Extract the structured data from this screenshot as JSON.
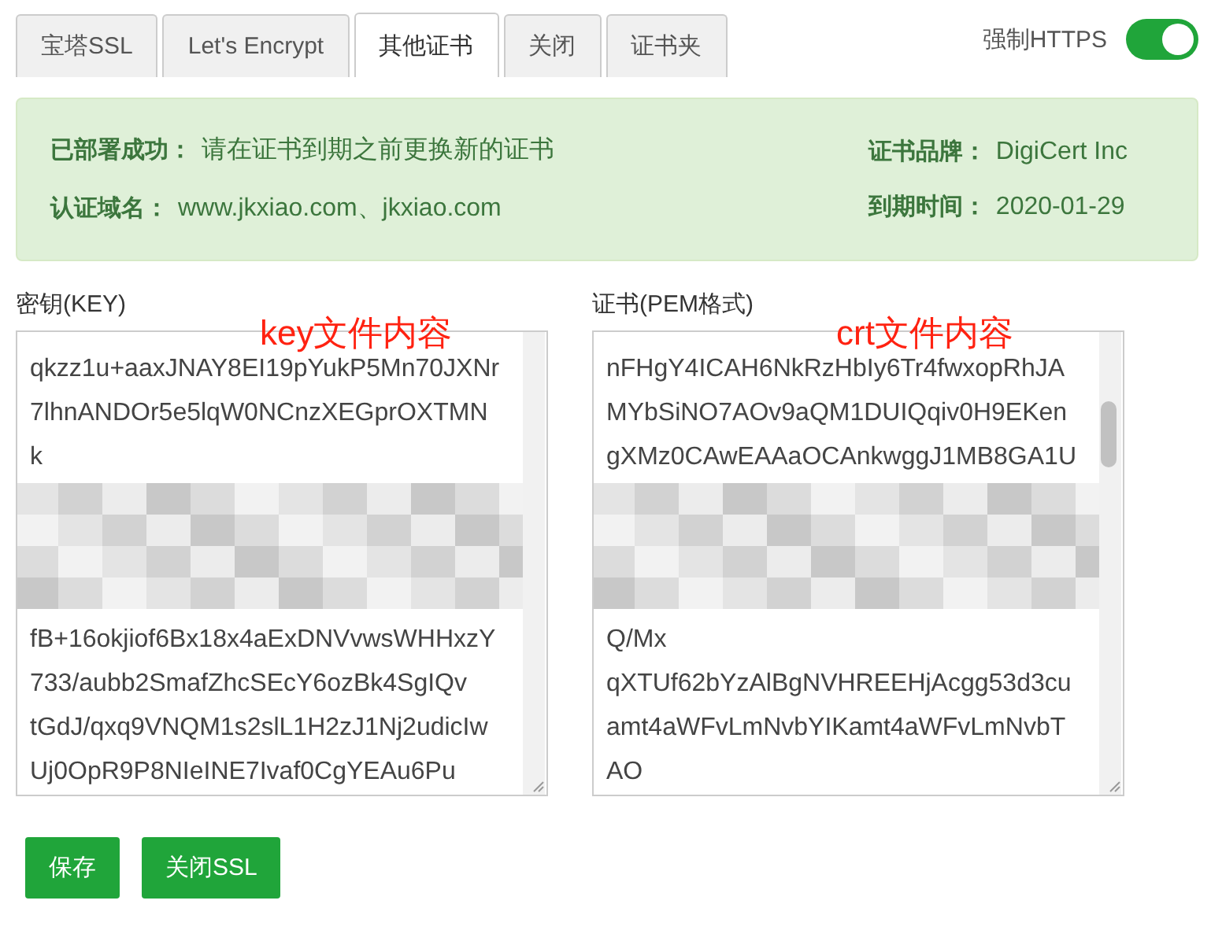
{
  "tabs": [
    {
      "label": "宝塔SSL",
      "selected": false
    },
    {
      "label": "Let's Encrypt",
      "selected": false
    },
    {
      "label": "其他证书",
      "selected": true
    },
    {
      "label": "关闭",
      "selected": false
    },
    {
      "label": "证书夹",
      "selected": false
    }
  ],
  "force_https": {
    "label": "强制HTTPS",
    "on": true
  },
  "info": {
    "left": [
      {
        "label": "已部署成功：",
        "value": "请在证书到期之前更换新的证书"
      },
      {
        "label": "认证域名：",
        "value": "www.jkxiao.com、jkxiao.com"
      }
    ],
    "right": [
      {
        "label": "证书品牌：",
        "value": "DigiCert Inc"
      },
      {
        "label": "到期时间：",
        "value": "2020-01-29"
      }
    ]
  },
  "editors": [
    {
      "label": "密钥(KEY)",
      "annotation": "key文件内容",
      "content": [
        {
          "kind": "text",
          "text": "qkzz1u+aaxJNAY8EI19pYukP5Mn70JXNr"
        },
        {
          "kind": "text",
          "text": "7lhnANDOr5e5lqW0NCnzXEGprOXTMN"
        },
        {
          "kind": "text",
          "text": "k"
        },
        {
          "kind": "redacted"
        },
        {
          "kind": "text",
          "text": "fB+16okjiof6Bx18x4aExDNVvwsWHHxzY"
        },
        {
          "kind": "text",
          "text": "733/aubb2SmafZhcSEcY6ozBk4SgIQv"
        },
        {
          "kind": "text",
          "text": "tGdJ/qxq9VNQM1s2slL1H2zJ1Nj2udicIw"
        },
        {
          "kind": "text",
          "text": "Uj0OpR9P8NIeINE7Ivaf0CgYEAu6Pu"
        }
      ]
    },
    {
      "label": "证书(PEM格式)",
      "annotation": "crt文件内容",
      "content": [
        {
          "kind": "text",
          "text": "nFHgY4ICAH6NkRzHbIy6Tr4fwxopRhJA"
        },
        {
          "kind": "text",
          "text": "MYbSiNO7AOv9aQM1DUIQqiv0H9EKen"
        },
        {
          "kind": "text",
          "text": "gXMz0CAwEAAaOCAnkwggJ1MB8GA1U"
        },
        {
          "kind": "redacted"
        },
        {
          "kind": "text",
          "text": "Q/Mx"
        },
        {
          "kind": "text",
          "text": "qXTUf62bYzAlBgNVHREEHjAcgg53d3cu"
        },
        {
          "kind": "text",
          "text": "amt4aWFvLmNvbYIKamt4aWFvLmNvbT"
        },
        {
          "kind": "text",
          "text": "AO"
        }
      ]
    }
  ],
  "buttons": [
    "保存",
    "关闭SSL"
  ]
}
